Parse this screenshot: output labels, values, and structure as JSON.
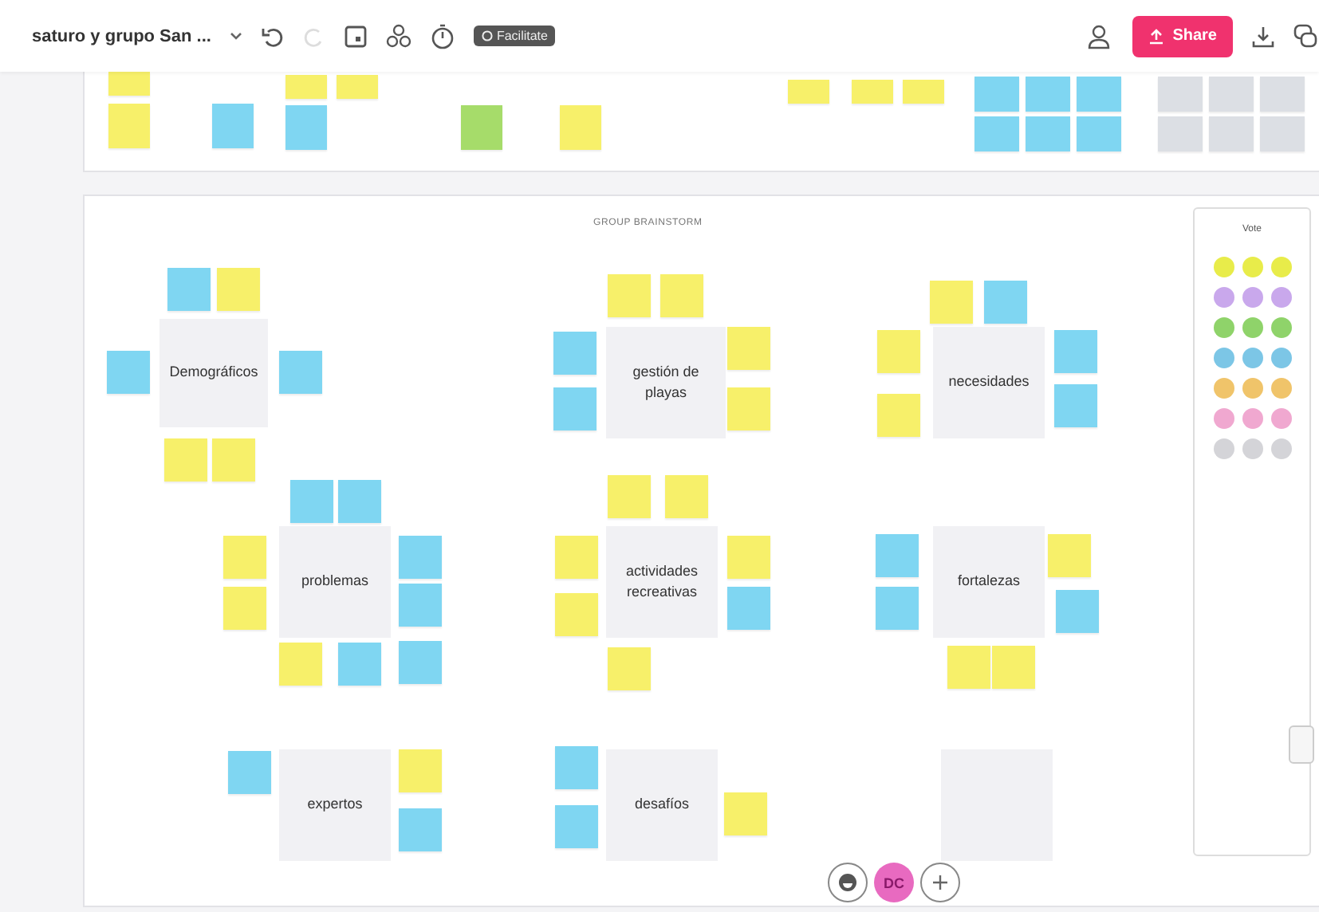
{
  "board_title": "saturo y grupo San ...",
  "facilitate_label": "Facilitate",
  "share_label": "Share",
  "top_notes": [
    {
      "color": "#f7f06a"
    },
    {
      "color": "#f7f06a"
    },
    {
      "color": "#7fd6f2"
    },
    {
      "color": "#f7f06a"
    },
    {
      "color": "#f7f06a"
    },
    {
      "color": "#7fd6f2"
    },
    {
      "color": "#a6dc6a"
    },
    {
      "color": "#f7f06a"
    },
    {
      "color": "#f7f06a"
    },
    {
      "color": "#f7f06a"
    },
    {
      "color": "#f7f06a"
    },
    {
      "color": "#7fd6f2"
    },
    {
      "color": "#7fd6f2"
    },
    {
      "color": "#7fd6f2"
    },
    {
      "color": "#7fd6f2"
    },
    {
      "color": "#7fd6f2"
    },
    {
      "color": "#7fd6f2"
    },
    {
      "color": "#dcdfe4"
    },
    {
      "color": "#dcdfe4"
    },
    {
      "color": "#dcdfe4"
    },
    {
      "color": "#dcdfe4"
    },
    {
      "color": "#dcdfe4"
    },
    {
      "color": "#dcdfe4"
    }
  ],
  "frame_title": "GROUP BRAINSTORM",
  "clusters": [
    {
      "label": "Demográficos",
      "notes": [
        {
          "color": "#7fd6f2"
        },
        {
          "color": "#f7f06a"
        },
        {
          "color": "#7fd6f2"
        },
        {
          "color": "#7fd6f2"
        },
        {
          "color": "#f7f06a"
        },
        {
          "color": "#f7f06a"
        }
      ]
    },
    {
      "label": "gestión de playas",
      "notes": [
        {
          "color": "#f7f06a"
        },
        {
          "color": "#f7f06a"
        },
        {
          "color": "#7fd6f2"
        },
        {
          "color": "#7fd6f2"
        },
        {
          "color": "#f7f06a"
        },
        {
          "color": "#f7f06a"
        }
      ]
    },
    {
      "label": "necesidades",
      "notes": [
        {
          "color": "#f7f06a"
        },
        {
          "color": "#7fd6f2"
        },
        {
          "color": "#f7f06a"
        },
        {
          "color": "#f7f06a"
        },
        {
          "color": "#7fd6f2"
        },
        {
          "color": "#7fd6f2"
        }
      ]
    },
    {
      "label": "problemas",
      "notes": [
        {
          "color": "#7fd6f2"
        },
        {
          "color": "#7fd6f2"
        },
        {
          "color": "#f7f06a"
        },
        {
          "color": "#f7f06a"
        },
        {
          "color": "#7fd6f2"
        },
        {
          "color": "#7fd6f2"
        },
        {
          "color": "#f7f06a"
        },
        {
          "color": "#7fd6f2"
        },
        {
          "color": "#7fd6f2"
        }
      ]
    },
    {
      "label": "actividades recreativas",
      "notes": [
        {
          "color": "#f7f06a"
        },
        {
          "color": "#f7f06a"
        },
        {
          "color": "#f7f06a"
        },
        {
          "color": "#f7f06a"
        },
        {
          "color": "#f7f06a"
        },
        {
          "color": "#7fd6f2"
        },
        {
          "color": "#f7f06a"
        }
      ]
    },
    {
      "label": "fortalezas",
      "notes": [
        {
          "color": "#7fd6f2"
        },
        {
          "color": "#7fd6f2"
        },
        {
          "color": "#f7f06a"
        },
        {
          "color": "#7fd6f2"
        },
        {
          "color": "#f7f06a"
        },
        {
          "color": "#f7f06a"
        }
      ]
    },
    {
      "label": "expertos",
      "notes": [
        {
          "color": "#7fd6f2"
        },
        {
          "color": "#f7f06a"
        },
        {
          "color": "#7fd6f2"
        }
      ]
    },
    {
      "label": "desafíos",
      "notes": [
        {
          "color": "#7fd6f2"
        },
        {
          "color": "#7fd6f2"
        },
        {
          "color": "#f7f06a"
        }
      ]
    }
  ],
  "blank_card": true,
  "vote_panel": {
    "title": "Vote",
    "dot_rows": [
      {
        "color": "#e8ec4a"
      },
      {
        "color": "#c9a8ec"
      },
      {
        "color": "#8fd36a"
      },
      {
        "color": "#7cc6e6"
      },
      {
        "color": "#f0c46a"
      },
      {
        "color": "#f0a8d0"
      },
      {
        "color": "#d4d4d8"
      }
    ]
  },
  "avatar_initials": "DC"
}
